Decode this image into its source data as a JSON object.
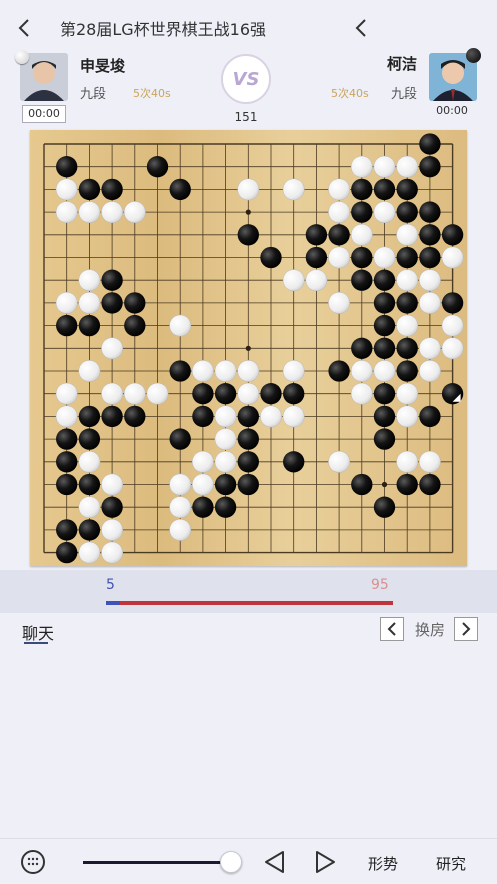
{
  "header": {
    "title": "第28届LG杯世界棋王战16强"
  },
  "player_left": {
    "name": "申旻埈",
    "rank": "九段",
    "time": "5次40s",
    "timer": "00:00",
    "stone": "white"
  },
  "player_right": {
    "name": "柯洁",
    "rank": "九段",
    "time": "5次40s",
    "timer": "00:00",
    "stone": "black"
  },
  "vs_label": "VS",
  "move_number": "151",
  "win_rate": {
    "left": "5",
    "right": "95",
    "left_color": "#3f53b4",
    "right_color": "#c0353c"
  },
  "chat": {
    "tab_label": "聊天",
    "room_label": "换房"
  },
  "toolbar": {
    "analysis_label": "形势",
    "research_label": "研究",
    "slider_value": 1.0
  },
  "board": {
    "size": 19,
    "star_points": [
      [
        3,
        3
      ],
      [
        3,
        9
      ],
      [
        3,
        15
      ],
      [
        9,
        3
      ],
      [
        9,
        9
      ],
      [
        9,
        15
      ],
      [
        15,
        3
      ],
      [
        15,
        9
      ],
      [
        15,
        15
      ]
    ],
    "last_move": [
      11,
      18
    ],
    "black": [
      [
        0,
        17
      ],
      [
        1,
        1
      ],
      [
        1,
        5
      ],
      [
        1,
        17
      ],
      [
        2,
        2
      ],
      [
        2,
        3
      ],
      [
        2,
        6
      ],
      [
        2,
        14
      ],
      [
        2,
        15
      ],
      [
        2,
        16
      ],
      [
        3,
        14
      ],
      [
        3,
        16
      ],
      [
        3,
        17
      ],
      [
        4,
        9
      ],
      [
        4,
        12
      ],
      [
        4,
        13
      ],
      [
        4,
        17
      ],
      [
        4,
        18
      ],
      [
        5,
        10
      ],
      [
        5,
        12
      ],
      [
        5,
        14
      ],
      [
        5,
        16
      ],
      [
        5,
        17
      ],
      [
        6,
        3
      ],
      [
        6,
        14
      ],
      [
        6,
        15
      ],
      [
        7,
        3
      ],
      [
        7,
        4
      ],
      [
        7,
        15
      ],
      [
        7,
        16
      ],
      [
        7,
        18
      ],
      [
        8,
        1
      ],
      [
        8,
        2
      ],
      [
        8,
        4
      ],
      [
        8,
        15
      ],
      [
        9,
        14
      ],
      [
        9,
        15
      ],
      [
        9,
        16
      ],
      [
        10,
        6
      ],
      [
        10,
        13
      ],
      [
        10,
        16
      ],
      [
        11,
        7
      ],
      [
        11,
        8
      ],
      [
        11,
        10
      ],
      [
        11,
        11
      ],
      [
        11,
        15
      ],
      [
        11,
        18
      ],
      [
        12,
        2
      ],
      [
        12,
        3
      ],
      [
        12,
        4
      ],
      [
        12,
        7
      ],
      [
        12,
        9
      ],
      [
        12,
        15
      ],
      [
        12,
        17
      ],
      [
        13,
        1
      ],
      [
        13,
        2
      ],
      [
        13,
        6
      ],
      [
        13,
        9
      ],
      [
        13,
        15
      ],
      [
        14,
        1
      ],
      [
        14,
        9
      ],
      [
        14,
        11
      ],
      [
        15,
        1
      ],
      [
        15,
        2
      ],
      [
        15,
        8
      ],
      [
        15,
        9
      ],
      [
        15,
        14
      ],
      [
        15,
        16
      ],
      [
        15,
        17
      ],
      [
        16,
        3
      ],
      [
        16,
        7
      ],
      [
        16,
        8
      ],
      [
        16,
        15
      ],
      [
        17,
        1
      ],
      [
        17,
        2
      ],
      [
        18,
        1
      ]
    ],
    "white": [
      [
        1,
        14
      ],
      [
        1,
        15
      ],
      [
        1,
        16
      ],
      [
        2,
        1
      ],
      [
        2,
        9
      ],
      [
        2,
        11
      ],
      [
        2,
        13
      ],
      [
        3,
        1
      ],
      [
        3,
        2
      ],
      [
        3,
        3
      ],
      [
        3,
        4
      ],
      [
        3,
        13
      ],
      [
        3,
        15
      ],
      [
        4,
        14
      ],
      [
        4,
        16
      ],
      [
        5,
        13
      ],
      [
        5,
        15
      ],
      [
        5,
        18
      ],
      [
        6,
        2
      ],
      [
        6,
        11
      ],
      [
        6,
        12
      ],
      [
        6,
        14
      ],
      [
        6,
        16
      ],
      [
        6,
        17
      ],
      [
        7,
        1
      ],
      [
        7,
        2
      ],
      [
        7,
        13
      ],
      [
        7,
        17
      ],
      [
        8,
        6
      ],
      [
        8,
        16
      ],
      [
        8,
        18
      ],
      [
        9,
        3
      ],
      [
        9,
        17
      ],
      [
        9,
        18
      ],
      [
        10,
        2
      ],
      [
        10,
        7
      ],
      [
        10,
        8
      ],
      [
        10,
        9
      ],
      [
        10,
        11
      ],
      [
        10,
        14
      ],
      [
        10,
        15
      ],
      [
        10,
        17
      ],
      [
        11,
        1
      ],
      [
        11,
        3
      ],
      [
        11,
        4
      ],
      [
        11,
        5
      ],
      [
        11,
        9
      ],
      [
        11,
        14
      ],
      [
        11,
        16
      ],
      [
        12,
        1
      ],
      [
        12,
        8
      ],
      [
        12,
        10
      ],
      [
        12,
        11
      ],
      [
        12,
        16
      ],
      [
        13,
        8
      ],
      [
        14,
        2
      ],
      [
        14,
        7
      ],
      [
        14,
        8
      ],
      [
        14,
        13
      ],
      [
        14,
        16
      ],
      [
        14,
        17
      ],
      [
        15,
        3
      ],
      [
        15,
        6
      ],
      [
        15,
        7
      ],
      [
        16,
        2
      ],
      [
        16,
        6
      ],
      [
        17,
        3
      ],
      [
        17,
        6
      ],
      [
        18,
        2
      ],
      [
        18,
        3
      ]
    ]
  }
}
